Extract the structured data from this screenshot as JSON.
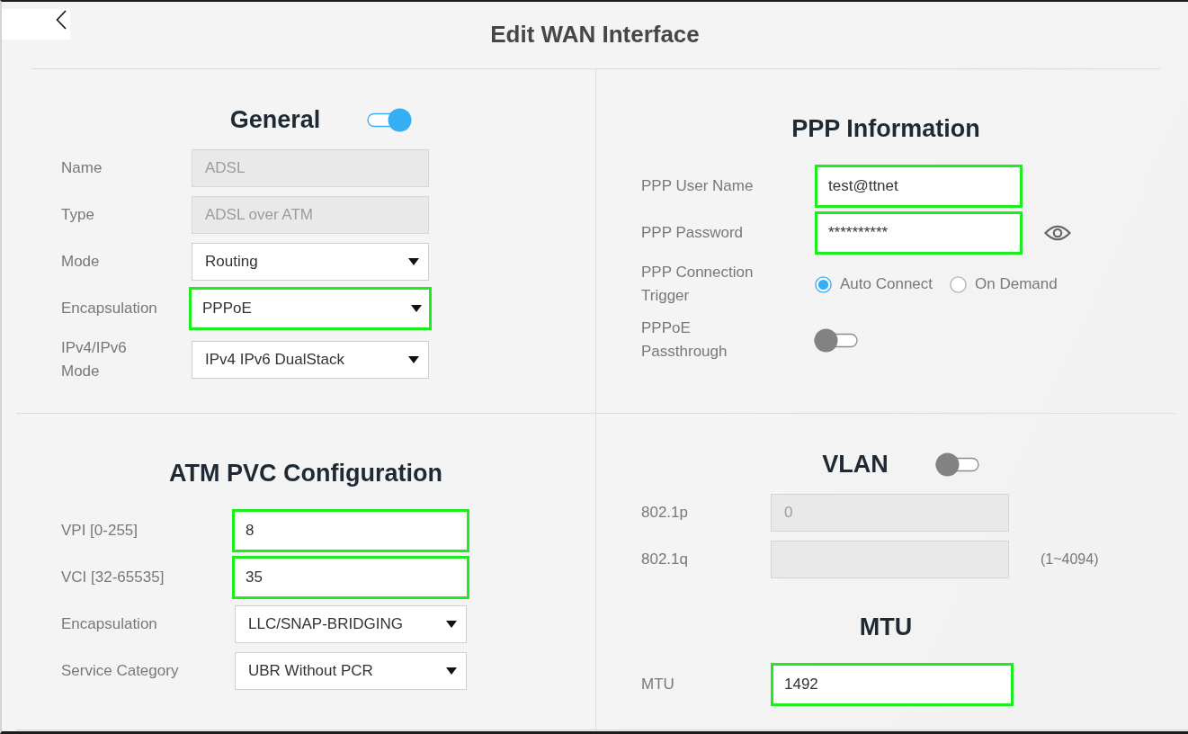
{
  "page": {
    "title": "Edit WAN Interface"
  },
  "panels": [
    {
      "sections": [
        {
          "title": "General",
          "toggle": {
            "on": true
          },
          "rows": [
            {
              "label": "Name",
              "kind": "text",
              "value": "ADSL",
              "disabled": true,
              "highlighted": false
            },
            {
              "label": "Type",
              "kind": "text",
              "value": "ADSL over ATM",
              "disabled": true,
              "highlighted": false
            },
            {
              "label": "Mode",
              "kind": "select",
              "value": "Routing",
              "highlighted": false
            },
            {
              "label": "Encapsulation",
              "kind": "select",
              "value": "PPPoE",
              "highlighted": true
            },
            {
              "label": "IPv4/IPv6 Mode",
              "kind": "select",
              "value": "IPv4 IPv6 DualStack",
              "highlighted": false
            }
          ]
        }
      ]
    },
    {
      "sections": [
        {
          "title": "PPP Information",
          "rows": [
            {
              "label": "PPP User Name",
              "kind": "text",
              "value": "test@ttnet",
              "disabled": false,
              "highlighted": true
            },
            {
              "label": "PPP Password",
              "kind": "password",
              "value": "**********",
              "disabled": false,
              "highlighted": true
            },
            {
              "label": "PPP Connection Trigger",
              "kind": "radio",
              "options": [
                {
                  "label": "Auto Connect",
                  "selected": true
                },
                {
                  "label": "On Demand",
                  "selected": false
                }
              ]
            },
            {
              "label": "PPPoE Passthrough",
              "kind": "switch",
              "on": false
            }
          ]
        }
      ]
    },
    {
      "sections": [
        {
          "title": "ATM PVC Configuration",
          "rows": [
            {
              "label": "VPI [0-255]",
              "kind": "text",
              "value": "8",
              "disabled": false,
              "highlighted": true
            },
            {
              "label": "VCI [32-65535]",
              "kind": "text",
              "value": "35",
              "disabled": false,
              "highlighted": true
            },
            {
              "label": "Encapsulation",
              "kind": "select",
              "value": "LLC/SNAP-BRIDGING",
              "highlighted": false
            },
            {
              "label": "Service Category",
              "kind": "select",
              "value": "UBR Without PCR",
              "highlighted": false
            }
          ]
        }
      ]
    },
    {
      "sections": [
        {
          "title": "VLAN",
          "toggle": {
            "on": false
          },
          "rows": [
            {
              "label": "802.1p",
              "kind": "text",
              "value": "0",
              "disabled": true,
              "highlighted": false
            },
            {
              "label": "802.1q",
              "kind": "text",
              "disabled": true,
              "highlighted": false,
              "hint": "(1~4094)"
            }
          ]
        },
        {
          "title": "MTU",
          "rows": [
            {
              "label": "MTU",
              "kind": "text",
              "value": "1492",
              "disabled": false,
              "highlighted": true
            }
          ]
        }
      ]
    }
  ]
}
